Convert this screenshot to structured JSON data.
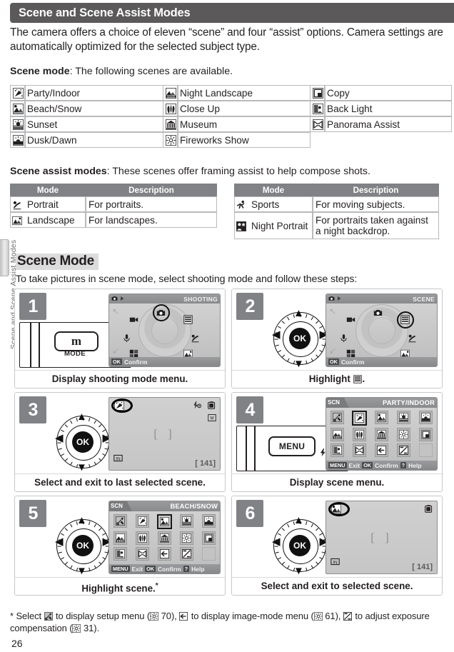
{
  "header": {
    "title": "Scene and Scene Assist Modes"
  },
  "intro": "The camera offers a choice of eleven “scene” and four “assist” options.  Camera settings are automatically optimized for the selected subject type.",
  "lead_scene_bold": "Scene mode",
  "lead_scene_rest": ": The following scenes are available.",
  "lead_assist_bold": "Scene assist modes",
  "lead_assist_rest": ": These scenes offer framing assist to help compose shots.",
  "scene_modes": {
    "col1": [
      {
        "icon": "party-indoor-icon",
        "label": "Party/Indoor"
      },
      {
        "icon": "beach-snow-icon",
        "label": "Beach/Snow"
      },
      {
        "icon": "sunset-icon",
        "label": "Sunset"
      },
      {
        "icon": "dusk-dawn-icon",
        "label": "Dusk/Dawn"
      }
    ],
    "col2": [
      {
        "icon": "night-landscape-icon",
        "label": "Night Landscape"
      },
      {
        "icon": "close-up-icon",
        "label": "Close Up"
      },
      {
        "icon": "museum-icon",
        "label": "Museum"
      },
      {
        "icon": "fireworks-show-icon",
        "label": "Fireworks Show"
      }
    ],
    "col3": [
      {
        "icon": "copy-icon",
        "label": "Copy"
      },
      {
        "icon": "back-light-icon",
        "label": "Back Light"
      },
      {
        "icon": "panorama-assist-icon",
        "label": "Panorama Assist"
      }
    ]
  },
  "assist_tables": {
    "headers": {
      "mode": "Mode",
      "description": "Description"
    },
    "left_rows": [
      {
        "icon": "portrait-icon",
        "mode": "Portrait",
        "description": "For portraits."
      },
      {
        "icon": "landscape-icon",
        "mode": "Landscape",
        "description": "For landscapes."
      }
    ],
    "right_rows": [
      {
        "icon": "sports-icon",
        "mode": "Sports",
        "description": "For moving subjects."
      },
      {
        "icon": "night-portrait-icon",
        "mode": "Night Portrait",
        "description": "For portraits taken against a night backdrop."
      }
    ]
  },
  "section": {
    "heading": "Scene Mode",
    "paragraph": "To take pictures in scene mode, select shooting mode and follow these steps:"
  },
  "steps": [
    {
      "number": "1",
      "caption": "Display shooting mode menu.",
      "screen": {
        "type": "mode-dial",
        "top_left_icon": "camera-icon",
        "top_left_arrow": "play-arrow-icon",
        "title": "SHOOTING",
        "bottom_key": "OK",
        "bottom_label": "Confirm",
        "dial_icons": [
          "movie-icon",
          "camera-icon",
          "scene-icon",
          "voice-icon",
          "portrait-icon",
          "multishot-icon",
          "sports-icon",
          "landscape-icon"
        ],
        "highlighted": "camera-icon"
      },
      "device": {
        "type": "mode-button",
        "button_label": "m",
        "caption_label": "MODE"
      }
    },
    {
      "number": "2",
      "caption_prefix": "Highlight ",
      "caption_icon": "scene-icon",
      "caption_suffix": ".",
      "screen": {
        "type": "mode-dial",
        "top_left_icon": "camera-icon",
        "top_left_arrow": "play-arrow-icon",
        "title": "SCENE",
        "bottom_key": "OK",
        "bottom_label": "Confirm",
        "highlighted": "scene-icon"
      },
      "device": {
        "type": "rotary-selector",
        "center_label": "OK"
      }
    },
    {
      "number": "3",
      "caption": "Select and exit to last selected scene.",
      "screen": {
        "type": "live-view",
        "mode_icon": "party-indoor-icon",
        "mode_icon_highlighted": true,
        "flash_icon": "red-eye-flash-icon",
        "battery_icon": "battery-icon",
        "image_mode_icon": "image-size-icon",
        "focus_brackets": "[  ]",
        "memory_icon": "internal-memory-icon",
        "shots_remaining": "141"
      },
      "device": {
        "type": "rotary-selector",
        "center_label": "OK"
      }
    },
    {
      "number": "4",
      "caption": "Display scene menu.",
      "screen": {
        "type": "scene-menu",
        "tab_label": "SCN",
        "title": "PARTY/INDOOR",
        "selected_index": 1,
        "icons": [
          "setup-icon",
          "party-indoor-icon",
          "beach-snow-icon",
          "sunset-icon",
          "dusk-dawn-icon",
          "night-landscape-icon",
          "close-up-icon",
          "museum-icon",
          "fireworks-show-icon",
          "copy-icon",
          "back-light-icon",
          "panorama-assist-icon",
          "image-mode-icon",
          "exposure-comp-icon",
          "blank"
        ],
        "footer": [
          {
            "key": "MENU",
            "label": "Exit"
          },
          {
            "key": "OK",
            "label": "Confirm"
          },
          {
            "key": "?",
            "label": "Help"
          }
        ]
      },
      "device": {
        "type": "menu-button",
        "button_label": "MENU",
        "flash_icon": "flash-icon"
      }
    },
    {
      "number": "5",
      "caption": "Highlight scene.",
      "caption_footnote": "*",
      "screen": {
        "type": "scene-menu",
        "tab_label": "SCN",
        "title": "BEACH/SNOW",
        "selected_index": 2,
        "icons": [
          "setup-icon",
          "party-indoor-icon",
          "beach-snow-icon",
          "sunset-icon",
          "dusk-dawn-icon",
          "night-landscape-icon",
          "close-up-icon",
          "museum-icon",
          "fireworks-show-icon",
          "copy-icon",
          "back-light-icon",
          "panorama-assist-icon",
          "image-mode-icon",
          "exposure-comp-icon",
          "blank"
        ],
        "footer": [
          {
            "key": "MENU",
            "label": "Exit"
          },
          {
            "key": "OK",
            "label": "Confirm"
          },
          {
            "key": "?",
            "label": "Help"
          }
        ]
      },
      "device": {
        "type": "rotary-selector",
        "center_label": "OK"
      }
    },
    {
      "number": "6",
      "caption": "Select and exit to selected scene.",
      "screen": {
        "type": "live-view",
        "mode_icon": "beach-snow-icon",
        "mode_icon_highlighted": true,
        "battery_icon": "battery-icon",
        "focus_brackets": "[  ]",
        "memory_icon": "internal-memory-icon",
        "shots_remaining": "141"
      },
      "device": {
        "type": "rotary-selector",
        "center_label": "OK"
      }
    }
  ],
  "footnote": {
    "marker": "*",
    "p1": " Select ",
    "icon1": "setup-icon",
    "p2": " to display setup menu (",
    "ref1": "70",
    "p3": "), ",
    "icon2": "image-mode-icon",
    "p4": " to display image-mode menu (",
    "ref2": "61",
    "p5": "), ",
    "icon3": "exposure-comp-icon",
    "p6": " to adjust exposure compensation (",
    "ref3": "31",
    "p7": ")."
  },
  "page_number": "26",
  "edge_tab_label": "Scene and Scene Assist Modes"
}
